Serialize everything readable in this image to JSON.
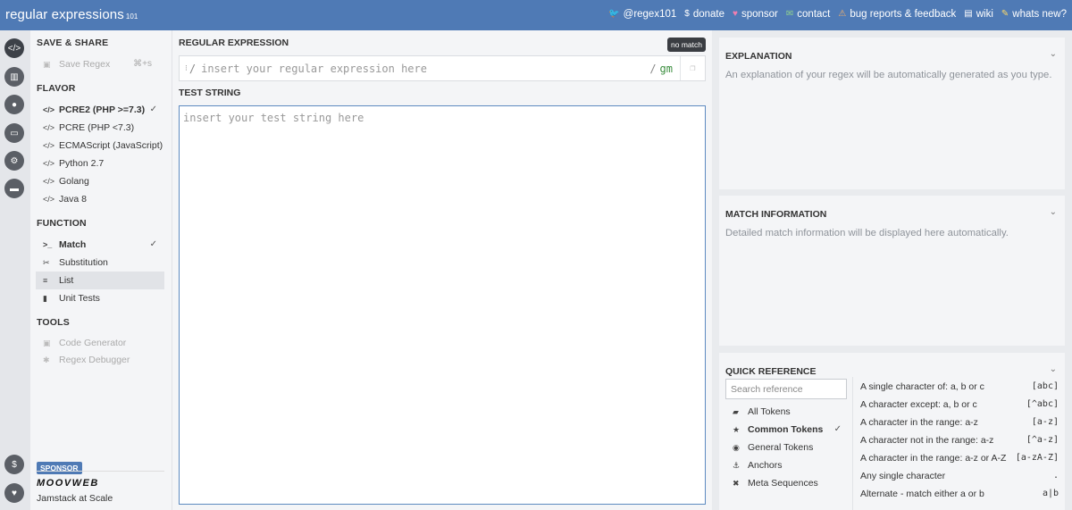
{
  "header": {
    "brand": "regular expressions",
    "brand_version": "101",
    "links": [
      {
        "icon": "twitter-icon",
        "glyph": "🐦",
        "label": "@regex101"
      },
      {
        "icon": "dollar-icon",
        "glyph": "$",
        "label": "donate"
      },
      {
        "icon": "heart-icon",
        "glyph": "♥",
        "label": "sponsor"
      },
      {
        "icon": "mail-icon",
        "glyph": "✉",
        "label": "contact"
      },
      {
        "icon": "warning-icon",
        "glyph": "⚠",
        "label": "bug reports & feedback"
      },
      {
        "icon": "wiki-icon",
        "glyph": "▤",
        "label": "wiki"
      },
      {
        "icon": "news-icon",
        "glyph": "✎",
        "label": "whats new?"
      }
    ]
  },
  "rail": {
    "icons": [
      "code-icon",
      "library-icon",
      "account-icon",
      "quiz-icon",
      "settings-icon",
      "chat-icon",
      "donate-icon",
      "heart-icon"
    ]
  },
  "sidebar": {
    "save_share": {
      "title": "SAVE & SHARE",
      "save_label": "Save Regex",
      "save_shortcut": "⌘+s"
    },
    "flavor": {
      "title": "FLAVOR",
      "items": [
        {
          "label": "PCRE2 (PHP >=7.3)",
          "selected": true
        },
        {
          "label": "PCRE (PHP <7.3)",
          "selected": false
        },
        {
          "label": "ECMAScript (JavaScript)",
          "selected": false
        },
        {
          "label": "Python 2.7",
          "selected": false
        },
        {
          "label": "Golang",
          "selected": false
        },
        {
          "label": "Java 8",
          "selected": false
        }
      ]
    },
    "function": {
      "title": "FUNCTION",
      "items": [
        {
          "label": "Match",
          "selected": true
        },
        {
          "label": "Substitution",
          "selected": false
        },
        {
          "label": "List",
          "selected": false
        },
        {
          "label": "Unit Tests",
          "selected": false
        }
      ]
    },
    "tools": {
      "title": "TOOLS",
      "items": [
        {
          "label": "Code Generator"
        },
        {
          "label": "Regex Debugger"
        }
      ]
    },
    "sponsor": {
      "badge": "SPONSOR",
      "logo": "MOOVWEB",
      "tagline": "Jamstack at Scale"
    }
  },
  "main": {
    "regex_title": "REGULAR EXPRESSION",
    "status": "no match",
    "regex": {
      "placeholder": "insert your regular expression here",
      "value": "",
      "delimiter_start": "/",
      "delimiter_end": "/",
      "flags": "gm"
    },
    "test_title": "TEST STRING",
    "test": {
      "placeholder": "insert your test string here",
      "value": ""
    }
  },
  "explanation": {
    "title": "EXPLANATION",
    "text": "An explanation of your regex will be automatically generated as you type."
  },
  "match_info": {
    "title": "MATCH INFORMATION",
    "text": "Detailed match information will be displayed here automatically."
  },
  "quick_reference": {
    "title": "QUICK REFERENCE",
    "search_placeholder": "Search reference",
    "categories": [
      {
        "label": "All Tokens",
        "selected": false
      },
      {
        "label": "Common Tokens",
        "selected": true
      },
      {
        "label": "General Tokens",
        "selected": false
      },
      {
        "label": "Anchors",
        "selected": false
      },
      {
        "label": "Meta Sequences",
        "selected": false
      }
    ],
    "entries": [
      {
        "desc": "A single character of: a, b or c",
        "token": "[abc]"
      },
      {
        "desc": "A character except: a, b or c",
        "token": "[^abc]"
      },
      {
        "desc": "A character in the range: a-z",
        "token": "[a-z]"
      },
      {
        "desc": "A character not in the range: a-z",
        "token": "[^a-z]"
      },
      {
        "desc": "A character in the range: a-z or A-Z",
        "token": "[a-zA-Z]"
      },
      {
        "desc": "Any single character",
        "token": "."
      },
      {
        "desc": "Alternate - match either a or b",
        "token": "a|b"
      }
    ]
  }
}
